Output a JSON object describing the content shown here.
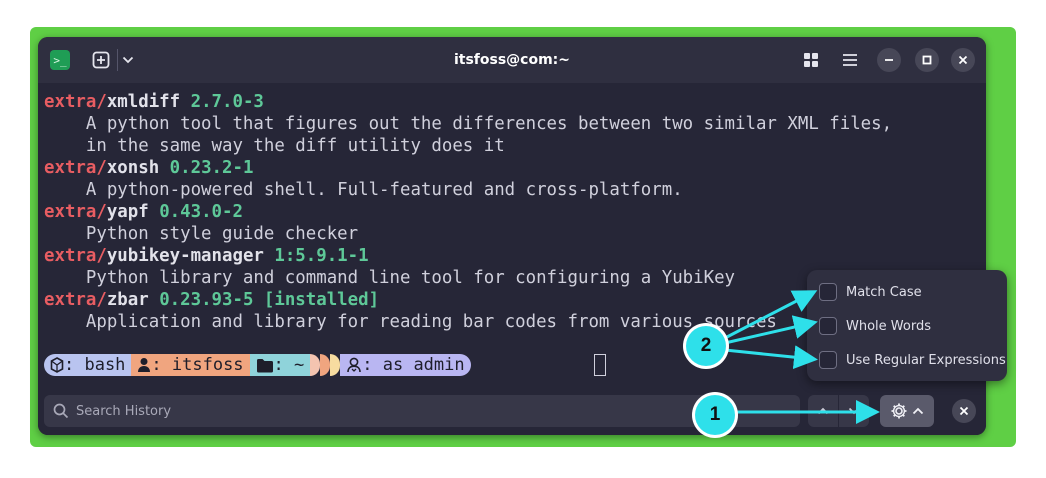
{
  "window": {
    "title": "itsfoss@com:~"
  },
  "titlebar": {
    "app_icon_glyph": ">_",
    "icons": [
      "terminal-app-icon",
      "new-tab-icon",
      "chevron-down-icon",
      "grid-view-icon",
      "hamburger-menu-icon",
      "minimize-icon",
      "maximize-icon",
      "close-icon"
    ]
  },
  "terminal": {
    "lines": [
      {
        "repo": "extra/",
        "pkg": "xmldiff",
        "ver": " 2.7.0-3",
        "inst": ""
      },
      {
        "desc": "    A python tool that figures out the differences between two similar XML files,"
      },
      {
        "desc": "    in the same way the diff utility does it"
      },
      {
        "repo": "extra/",
        "pkg": "xonsh",
        "ver": " 0.23.2-1",
        "inst": ""
      },
      {
        "desc": "    A python-powered shell. Full-featured and cross-platform."
      },
      {
        "repo": "extra/",
        "pkg": "yapf",
        "ver": " 0.43.0-2",
        "inst": ""
      },
      {
        "desc": "    Python style guide checker"
      },
      {
        "repo": "extra/",
        "pkg": "yubikey-manager",
        "ver": " 1:5.9.1-1",
        "inst": ""
      },
      {
        "desc": "    Python library and command line tool for configuring a YubiKey"
      },
      {
        "repo": "extra/",
        "pkg": "zbar",
        "ver": " 0.23.93-5",
        "inst": " [installed]"
      },
      {
        "desc": "    Application and library for reading bar codes from various sources"
      }
    ],
    "prompt": {
      "shell": ": bash",
      "user": ": itsfoss",
      "dir": ": ~",
      "admin": ": as admin"
    }
  },
  "search": {
    "placeholder": "Search History",
    "value": ""
  },
  "search_options": {
    "match_case": "Match Case",
    "whole_words": "Whole Words",
    "regex": "Use Regular Expressions"
  },
  "annotations": {
    "one": "1",
    "two": "2"
  },
  "colors": {
    "desktop_green": "#5fcf45",
    "terminal_bg": "#262637",
    "repo_red": "#e85d62",
    "version_green": "#5ec898",
    "annotation_cyan": "#2ee0ea"
  }
}
